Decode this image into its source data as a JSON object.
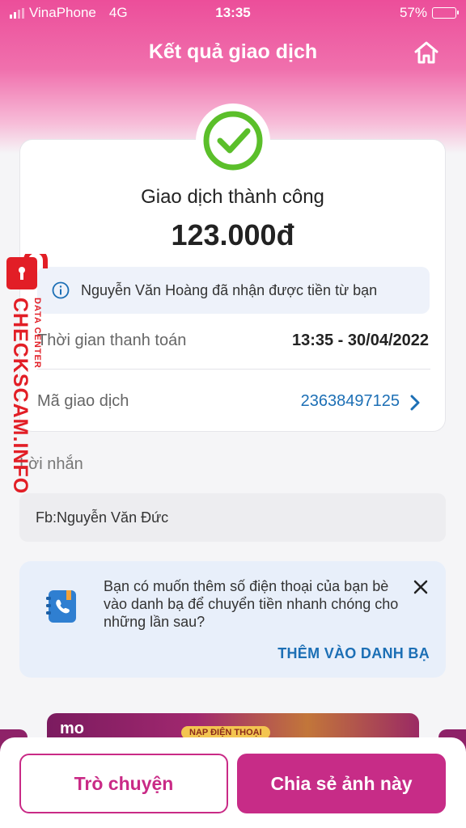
{
  "status_bar": {
    "carrier": "VinaPhone",
    "network": "4G",
    "time": "13:35",
    "battery": "57%",
    "battery_level": 0.57
  },
  "header": {
    "title": "Kết quả giao dịch",
    "home_icon": "home-icon"
  },
  "result": {
    "status_icon": "check-circle-icon",
    "title": "Giao dịch thành công",
    "amount": "123.000đ",
    "info_text": "Nguyễn Văn Hoàng đã nhận được tiền từ bạn",
    "time_label": "Thời gian thanh toán",
    "time_value": "13:35 - 30/04/2022",
    "txid_label": "Mã giao dịch",
    "txid_value": "23638497125"
  },
  "message": {
    "label": "Lời nhắn",
    "text": "Fb:Nguyễn Văn Đức"
  },
  "contact_prompt": {
    "text": "Bạn có muốn thêm số điện thoại của bạn bè vào danh bạ để chuyển tiền nhanh chóng cho những lần sau?",
    "action": "THÊM VÀO DANH BẠ"
  },
  "banner": {
    "logo": "mo",
    "button": "NẠP ĐIỆN THOẠI"
  },
  "actions": {
    "chat": "Trò chuyện",
    "share": "Chia sẻ ảnh này"
  },
  "watermark": {
    "main": "CHECKSCAM.INFO",
    "sub": "DATA CENTER"
  },
  "colors": {
    "brand_pink": "#c72c87",
    "success_green": "#5bbf2a",
    "link_blue": "#1c6fb5",
    "watermark_red": "#e21e26"
  }
}
